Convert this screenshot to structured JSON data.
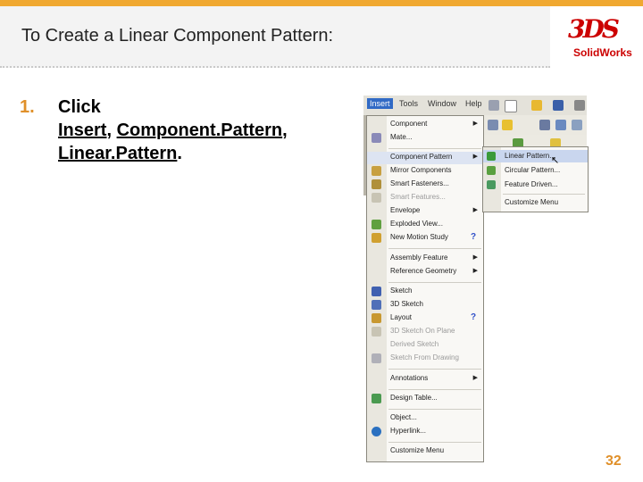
{
  "slide": {
    "title": "To Create a Linear Component Pattern:",
    "step_number": "1.",
    "step_click": "Click",
    "step_insert": "Insert",
    "step_comma1": ",",
    "step_component_pattern": "Component.Pattern",
    "step_comma2": ",",
    "step_linear_pattern": "Linear.Pattern",
    "step_period": ".",
    "page_number": "32"
  },
  "logo": {
    "mark": "3DS",
    "text": "SolidWorks"
  },
  "menubar": [
    "Insert",
    "Tools",
    "Window",
    "Help"
  ],
  "insert_menu": [
    {
      "label": "Component",
      "submenu": true
    },
    {
      "label": "Mate...",
      "icon": "paperclip-icon"
    },
    {
      "label": "Component Pattern",
      "submenu": true,
      "highlighted": true
    },
    {
      "label": "Mirror Components",
      "icon": "mirror-icon"
    },
    {
      "label": "Smart Fasteners...",
      "icon": "fastener-icon"
    },
    {
      "label": "Smart Features...",
      "disabled": true
    },
    {
      "label": "Envelope",
      "submenu": true
    },
    {
      "label": "Exploded View...",
      "icon": "explode-icon"
    },
    {
      "label": "New Motion Study",
      "icon": "motion-icon",
      "help": "?"
    },
    {
      "label": "Assembly Feature",
      "submenu": true
    },
    {
      "label": "Reference Geometry",
      "submenu": true
    },
    {
      "label": "Sketch",
      "icon": "sketch-icon"
    },
    {
      "label": "3D Sketch",
      "icon": "sketch3d-icon"
    },
    {
      "label": "Layout",
      "icon": "layout-icon",
      "help": "?"
    },
    {
      "label": "3D Sketch On Plane",
      "disabled": true
    },
    {
      "label": "Derived Sketch",
      "disabled": true
    },
    {
      "label": "Sketch From Drawing",
      "disabled": true
    },
    {
      "label": "Annotations",
      "submenu": true
    },
    {
      "label": "Design Table...",
      "icon": "table-icon"
    },
    {
      "label": "Object..."
    },
    {
      "label": "Hyperlink...",
      "icon": "globe-icon"
    },
    {
      "label": "Customize Menu"
    }
  ],
  "submenu": [
    {
      "label": "Linear Pattern...",
      "highlighted": true
    },
    {
      "label": "Circular Pattern..."
    },
    {
      "label": "Feature Driven..."
    },
    {
      "label": "Customize Menu"
    }
  ],
  "colors": {
    "accent": "#f0a830",
    "number": "#e0902a",
    "menu_highlight": "#316ac5"
  }
}
